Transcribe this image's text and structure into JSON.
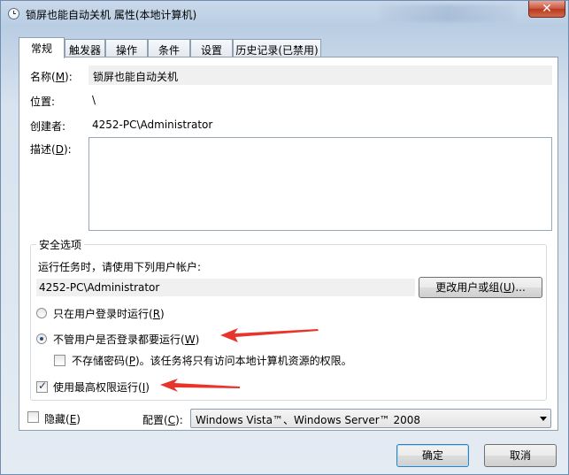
{
  "window": {
    "title": "锁屏也能自动关机 属性(本地计算机)",
    "close_label": "✕"
  },
  "tabs": [
    {
      "label": "常规"
    },
    {
      "label": "触发器"
    },
    {
      "label": "操作"
    },
    {
      "label": "条件"
    },
    {
      "label": "设置"
    },
    {
      "label": "历史记录(已禁用)"
    }
  ],
  "general": {
    "name_label_pre": "名称(",
    "name_label_key": "M",
    "name_label_post": "):",
    "name_value": "锁屏也能自动关机",
    "location_label": "位置:",
    "location_value": "\\",
    "author_label": "创建者:",
    "author_value": "4252-PC\\Administrator",
    "desc_label_pre": "描述(",
    "desc_label_key": "D",
    "desc_label_post": "):",
    "desc_value": ""
  },
  "security": {
    "title": "安全选项",
    "run_as_text": "运行任务时，请使用下列用户帐户:",
    "user_account": "4252-PC\\Administrator",
    "change_user_pre": "更改用户或组(",
    "change_user_key": "U",
    "change_user_post": ")...",
    "radio_logged_on_pre": "只在用户登录时运行(",
    "radio_logged_on_key": "R",
    "radio_logged_on_post": ")",
    "radio_logged_on_selected": false,
    "radio_whether_pre": "不管用户是否登录都要运行(",
    "radio_whether_key": "W",
    "radio_whether_post": ")",
    "radio_whether_selected": true,
    "no_store_pre": "不存储密码(",
    "no_store_key": "P",
    "no_store_post": ")。该任务将只有访问本地计算机资源的权限。",
    "no_store_checked": false,
    "highest_pre": "使用最高权限运行(",
    "highest_key": "I",
    "highest_post": ")",
    "highest_checked": true
  },
  "footer": {
    "hidden_pre": "隐藏(",
    "hidden_key": "E",
    "hidden_post": ")",
    "hidden_checked": false,
    "config_pre": "配置(",
    "config_key": "C",
    "config_post": "):",
    "config_value": "Windows Vista™、Windows Server™ 2008",
    "ok_label": "确定",
    "cancel_label": "取消"
  },
  "colors": {
    "annotation_arrow": "#e8352b"
  },
  "icons": {
    "title_icon": "clock-icon",
    "dropdown": "chevron-down-icon"
  }
}
